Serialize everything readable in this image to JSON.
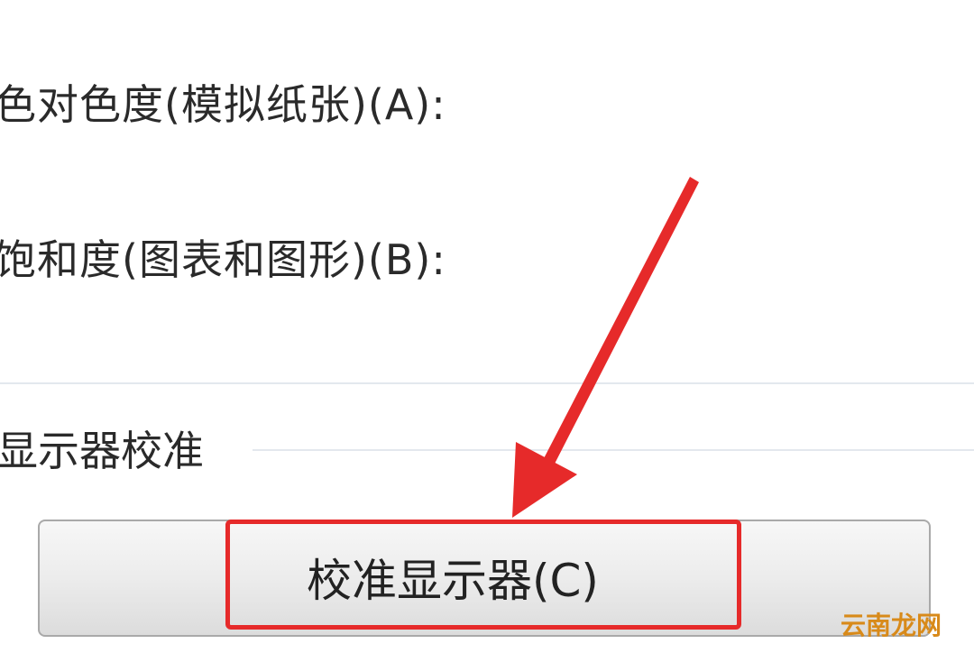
{
  "settings": {
    "absolute_colorimetric_label": "色对色度(模拟纸张)(A):",
    "saturation_label": "饱和度(图表和图形)(B):"
  },
  "display_calibration": {
    "group_title": "显示器校准",
    "calibrate_button_label": "校准显示器(C)"
  },
  "annotation": {
    "highlight_color": "#e62a2a",
    "arrow_color": "#e62a2a"
  },
  "watermark": {
    "text": "云南龙网"
  }
}
